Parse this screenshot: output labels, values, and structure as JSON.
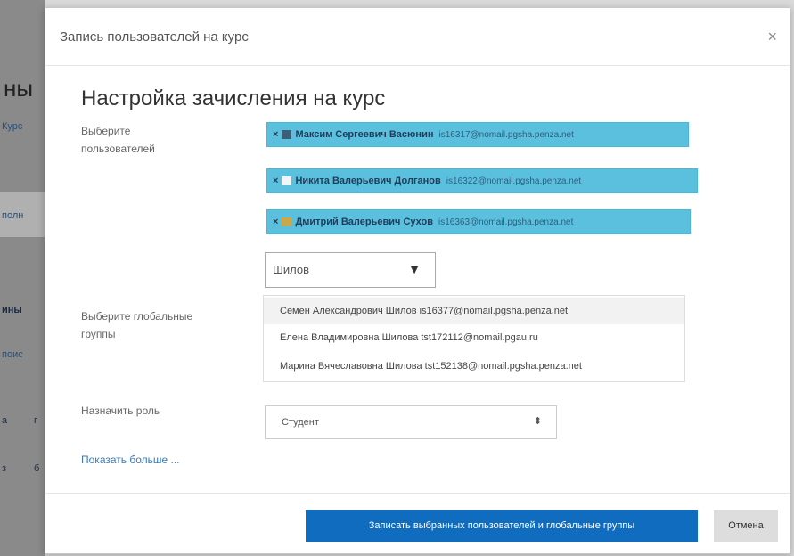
{
  "background": {
    "fragments": [
      "ны",
      "Курс",
      "полн",
      "ины",
      "поис",
      "а",
      "г",
      "з",
      "б"
    ]
  },
  "modal": {
    "title": "Запись пользователей на курс",
    "close_glyph": "×",
    "heading": "Настройка зачисления на курс",
    "users_label": "Выберите пользователей",
    "selected_users": [
      {
        "name": "Максим Сергеевич Васюнин",
        "email": "is16317@nomail.pgsha.penza.net"
      },
      {
        "name": "Никита Валерьевич Долганов",
        "email": "is16322@nomail.pgsha.penza.net"
      },
      {
        "name": "Дмитрий Валерьевич Сухов",
        "email": "is16363@nomail.pgsha.penza.net"
      }
    ],
    "search_value": "Шилов",
    "suggestions": [
      "Семен Александрович Шилов is16377@nomail.pgsha.penza.net",
      "Елена Владимировна Шилова tst172112@nomail.pgau.ru",
      "Марина Вячеславовна Шилова tst152138@nomail.pgsha.penza.net"
    ],
    "groups_label": "Выберите глобальные группы",
    "role_label": "Назначить роль",
    "role_value": "Студент",
    "show_more": "Показать больше ...",
    "submit_label": "Записать выбранных пользователей и глобальные группы",
    "cancel_label": "Отмена"
  },
  "colors": {
    "chip_bg": "#5bc0de",
    "primary": "#0f6cbf",
    "link": "#3b7ab5"
  }
}
